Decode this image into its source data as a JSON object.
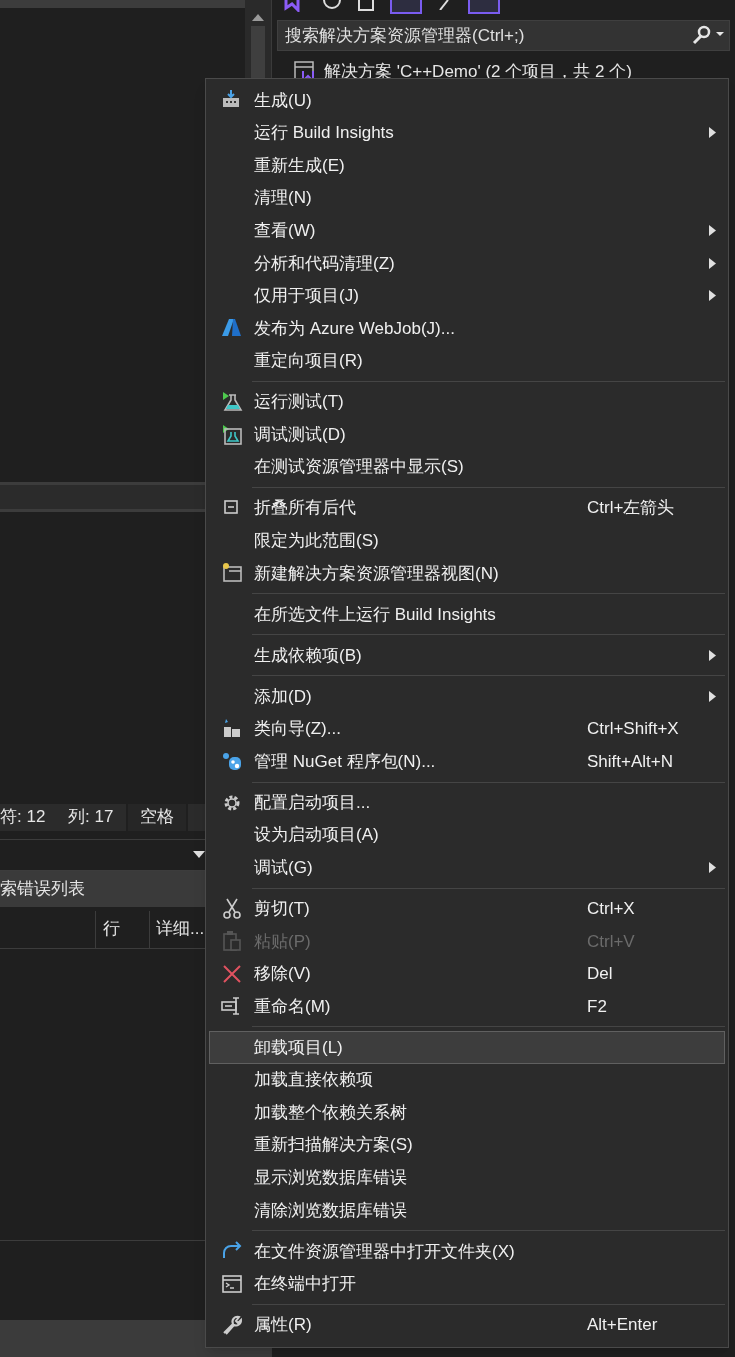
{
  "solution_explorer": {
    "search": {
      "placeholder": "搜索解决方案资源管理器(Ctrl+;)"
    },
    "tree": [
      {
        "label": "解决方案 'C++Demo' (2 个项目，共 2 个)"
      }
    ]
  },
  "editor_status": {
    "items": [
      "符: 12",
      "列: 17",
      "空格"
    ]
  },
  "error_list": {
    "title": "索错误列表",
    "columns": [
      "行",
      "详细..."
    ]
  },
  "context_menu": {
    "items": [
      {
        "kind": "item",
        "label": "生成(U)"
      },
      {
        "kind": "item",
        "label": "运行 Build Insights",
        "submenu": true
      },
      {
        "kind": "item",
        "label": "重新生成(E)"
      },
      {
        "kind": "item",
        "label": "清理(N)"
      },
      {
        "kind": "item",
        "label": "查看(W)",
        "submenu": true
      },
      {
        "kind": "item",
        "label": "分析和代码清理(Z)",
        "submenu": true
      },
      {
        "kind": "item",
        "label": "仅用于项目(J)",
        "submenu": true
      },
      {
        "kind": "item",
        "label": "发布为 Azure WebJob(J)..."
      },
      {
        "kind": "item",
        "label": "重定向项目(R)"
      },
      {
        "kind": "separator"
      },
      {
        "kind": "item",
        "label": "运行测试(T)"
      },
      {
        "kind": "item",
        "label": "调试测试(D)"
      },
      {
        "kind": "item",
        "label": "在测试资源管理器中显示(S)"
      },
      {
        "kind": "separator"
      },
      {
        "kind": "item",
        "label": "折叠所有后代",
        "shortcut": "Ctrl+左箭头"
      },
      {
        "kind": "item",
        "label": "限定为此范围(S)"
      },
      {
        "kind": "item",
        "label": "新建解决方案资源管理器视图(N)"
      },
      {
        "kind": "separator"
      },
      {
        "kind": "item",
        "label": "在所选文件上运行 Build Insights"
      },
      {
        "kind": "separator"
      },
      {
        "kind": "item",
        "label": "生成依赖项(B)",
        "submenu": true
      },
      {
        "kind": "separator"
      },
      {
        "kind": "item",
        "label": "添加(D)",
        "submenu": true
      },
      {
        "kind": "item",
        "label": "类向导(Z)...",
        "shortcut": "Ctrl+Shift+X"
      },
      {
        "kind": "item",
        "label": "管理 NuGet 程序包(N)...",
        "shortcut": "Shift+Alt+N"
      },
      {
        "kind": "separator"
      },
      {
        "kind": "item",
        "label": "配置启动项目..."
      },
      {
        "kind": "item",
        "label": "设为启动项目(A)"
      },
      {
        "kind": "item",
        "label": "调试(G)",
        "submenu": true
      },
      {
        "kind": "separator"
      },
      {
        "kind": "item",
        "label": "剪切(T)",
        "shortcut": "Ctrl+X"
      },
      {
        "kind": "item",
        "label": "粘贴(P)",
        "shortcut": "Ctrl+V",
        "disabled": true
      },
      {
        "kind": "item",
        "label": "移除(V)",
        "shortcut": "Del"
      },
      {
        "kind": "item",
        "label": "重命名(M)",
        "shortcut": "F2"
      },
      {
        "kind": "separator"
      },
      {
        "kind": "item",
        "label": "卸载项目(L)",
        "selected": true
      },
      {
        "kind": "item",
        "label": "加载直接依赖项"
      },
      {
        "kind": "item",
        "label": "加载整个依赖关系树"
      },
      {
        "kind": "item",
        "label": "重新扫描解决方案(S)"
      },
      {
        "kind": "item",
        "label": "显示浏览数据库错误"
      },
      {
        "kind": "item",
        "label": "清除浏览数据库错误"
      },
      {
        "kind": "separator"
      },
      {
        "kind": "item",
        "label": "在文件资源管理器中打开文件夹(X)"
      },
      {
        "kind": "item",
        "label": "在终端中打开"
      },
      {
        "kind": "separator"
      },
      {
        "kind": "item",
        "label": "属性(R)",
        "shortcut": "Alt+Enter"
      }
    ]
  }
}
